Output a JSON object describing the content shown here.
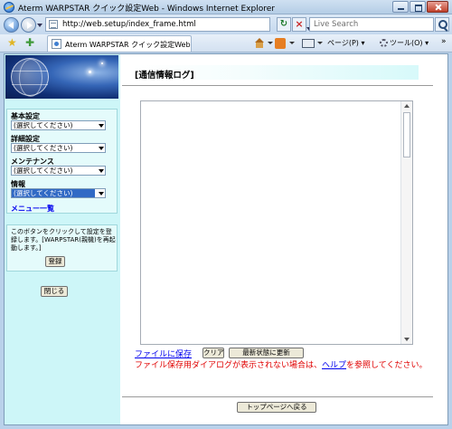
{
  "window": {
    "title": "Aterm WARPSTAR クイック設定Web - Windows Internet Explorer",
    "address": "http://web.setup/index_frame.html",
    "search_placeholder": "Live Search",
    "tab_title": "Aterm WARPSTAR クイック設定Web",
    "cmd_page": "ページ(P)",
    "cmd_tools": "ツール(O)",
    "cmd_more": "»"
  },
  "sidebar": {
    "sections": [
      {
        "label": "基本設定",
        "select": "(選択してください)"
      },
      {
        "label": "詳細設定",
        "select": "(選択してください)"
      },
      {
        "label": "メンテナンス",
        "select": "(選択してください)"
      },
      {
        "label": "情報",
        "select": "(選択してください)"
      }
    ],
    "menu_list_link": "メニュー一覧",
    "save_note": "このボタンをクリックして設定を登録します。[WARPSTAR(親機)を再起動します。]",
    "save_button": "登録",
    "close_button": "閉じる"
  },
  "main": {
    "title": "[通信情報ログ]",
    "file_save_link": "ファイルに保存",
    "clear_button": "クリア",
    "refresh_button": "最新状態に更新",
    "warning_prefix": "ファイル保存用ダイアログが表示されない場合は、",
    "warning_link": "ヘルプ",
    "warning_suffix": "を参照してください。",
    "top_page_button": "トップページへ戻る"
  },
  "colors": {
    "sidebar_bg": "#cdf6f8",
    "warning_text": "#e00000",
    "link": "#0000ee",
    "selected_select": "#316ac5"
  }
}
